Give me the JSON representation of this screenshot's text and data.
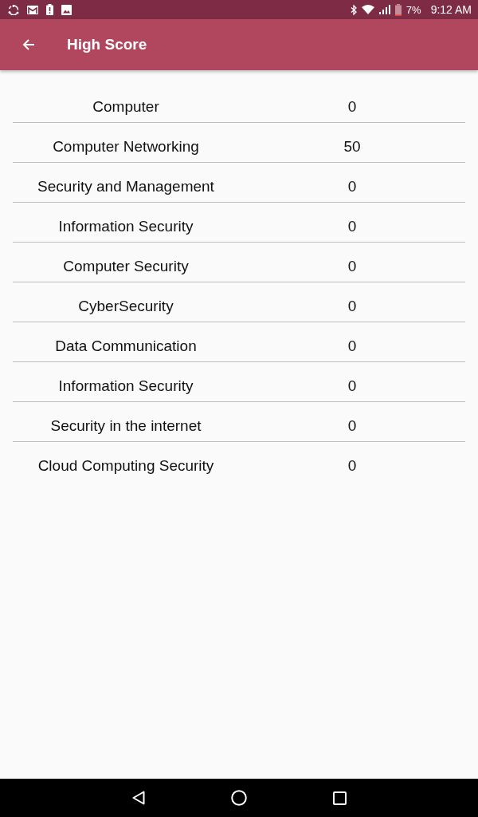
{
  "status_bar": {
    "battery_percent": "7%",
    "time": "9:12 AM"
  },
  "app_bar": {
    "title": "High Score"
  },
  "scores": [
    {
      "topic": "Computer",
      "score": "0"
    },
    {
      "topic": "Computer Networking",
      "score": "50"
    },
    {
      "topic": "Security and Management",
      "score": "0"
    },
    {
      "topic": "Information Security",
      "score": "0"
    },
    {
      "topic": "Computer Security",
      "score": "0"
    },
    {
      "topic": "CyberSecurity",
      "score": "0"
    },
    {
      "topic": "Data Communication",
      "score": "0"
    },
    {
      "topic": "Information Security",
      "score": "0"
    },
    {
      "topic": "Security in the internet",
      "score": "0"
    },
    {
      "topic": "Cloud Computing Security",
      "score": "0"
    }
  ]
}
